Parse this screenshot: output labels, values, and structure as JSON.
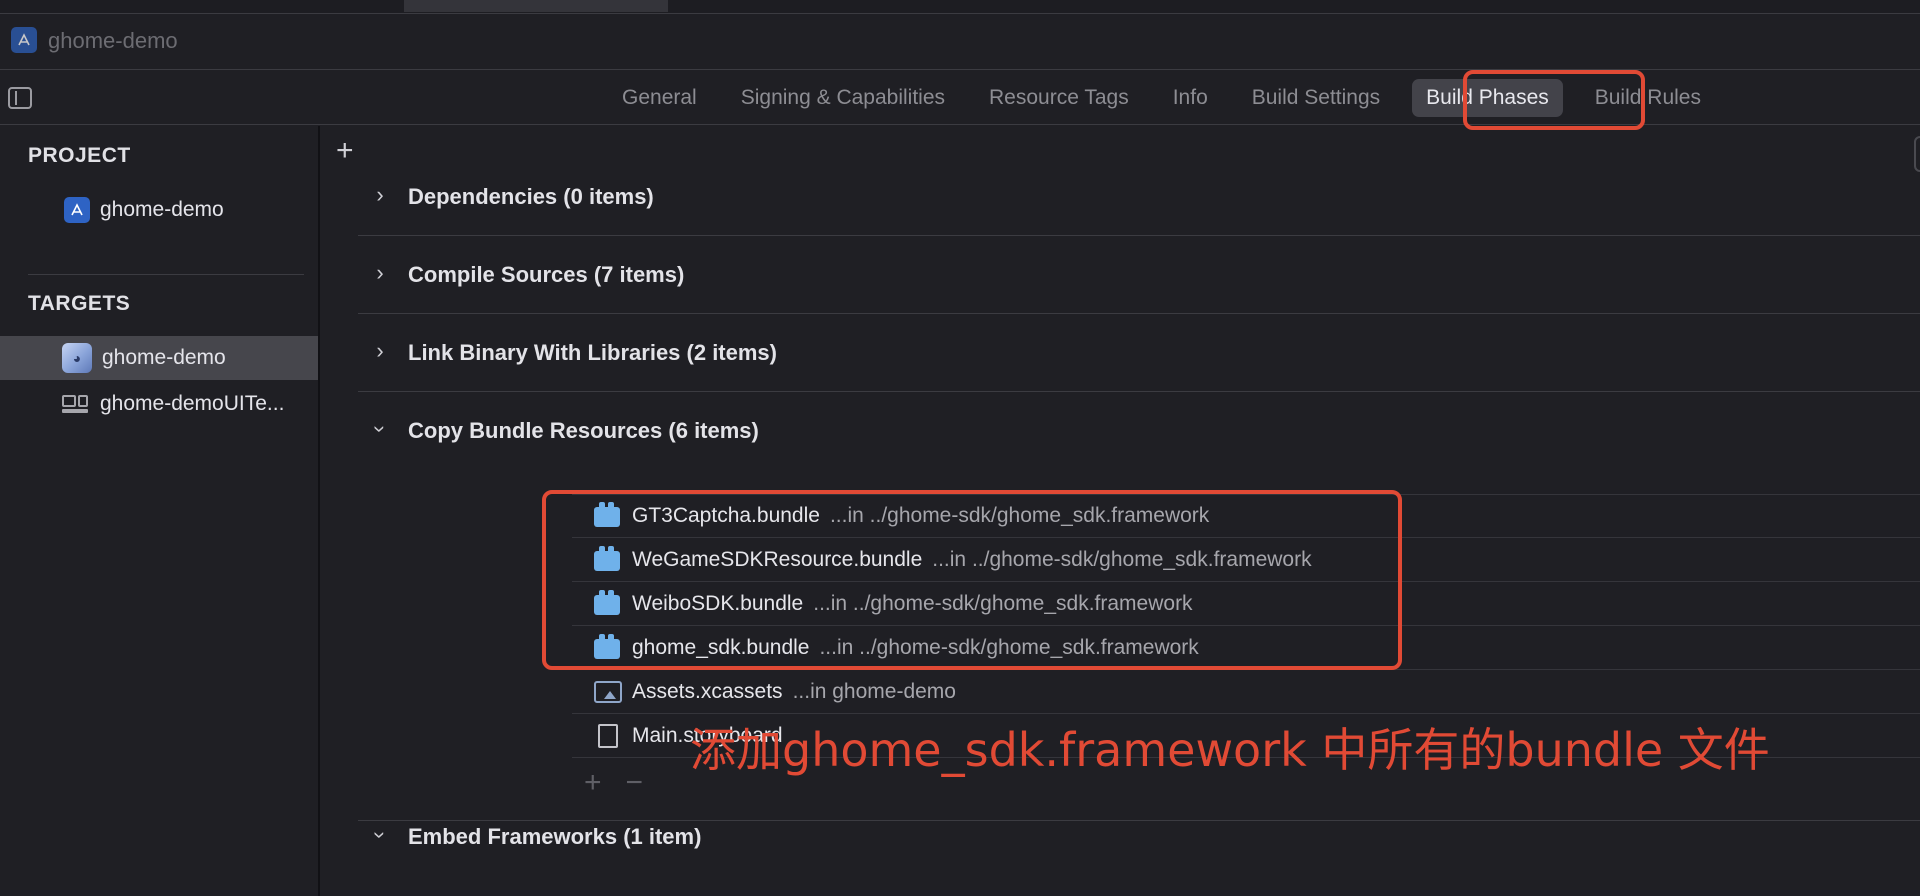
{
  "window": {
    "title": "ghome-demo"
  },
  "tabs": [
    {
      "label": "General"
    },
    {
      "label": "Signing & Capabilities"
    },
    {
      "label": "Resource Tags"
    },
    {
      "label": "Info"
    },
    {
      "label": "Build Settings"
    },
    {
      "label": "Build Phases",
      "active": true
    },
    {
      "label": "Build Rules"
    }
  ],
  "sidebar": {
    "project_header": "PROJECT",
    "project_item": "ghome-demo",
    "targets_header": "TARGETS",
    "targets": [
      {
        "label": "ghome-demo",
        "selected": true
      },
      {
        "label": "ghome-demoUITe..."
      }
    ]
  },
  "main": {
    "add_button": "+",
    "phases": [
      {
        "title": "Dependencies (0 items)",
        "expanded": false
      },
      {
        "title": "Compile Sources (7 items)",
        "expanded": false
      },
      {
        "title": "Link Binary With Libraries (2 items)",
        "expanded": false
      },
      {
        "title": "Copy Bundle Resources (6 items)",
        "expanded": true
      },
      {
        "title": "Embed Frameworks (1 item)",
        "expanded": true
      }
    ],
    "resources": [
      {
        "name": "GT3Captcha.bundle",
        "path": "...in ../ghome-sdk/ghome_sdk.framework",
        "icon": "bundle-icon"
      },
      {
        "name": "WeGameSDKResource.bundle",
        "path": "...in ../ghome-sdk/ghome_sdk.framework",
        "icon": "bundle-icon"
      },
      {
        "name": "WeiboSDK.bundle",
        "path": "...in ../ghome-sdk/ghome_sdk.framework",
        "icon": "bundle-icon"
      },
      {
        "name": "ghome_sdk.bundle",
        "path": "...in ../ghome-sdk/ghome_sdk.framework",
        "icon": "bundle-icon"
      },
      {
        "name": "Assets.xcassets",
        "path": "...in ghome-demo",
        "icon": "asset-catalog-icon"
      },
      {
        "name": "Main.storyboard",
        "path": "",
        "icon": "document-icon"
      }
    ],
    "add_resource": "+",
    "remove_resource": "−"
  },
  "annotation": "添加ghome_sdk.framework 中所有的bundle 文件",
  "colors": {
    "accent_highlight": "#e14a35",
    "bundle_icon": "#6fb1ea",
    "background": "#1f1f24"
  }
}
